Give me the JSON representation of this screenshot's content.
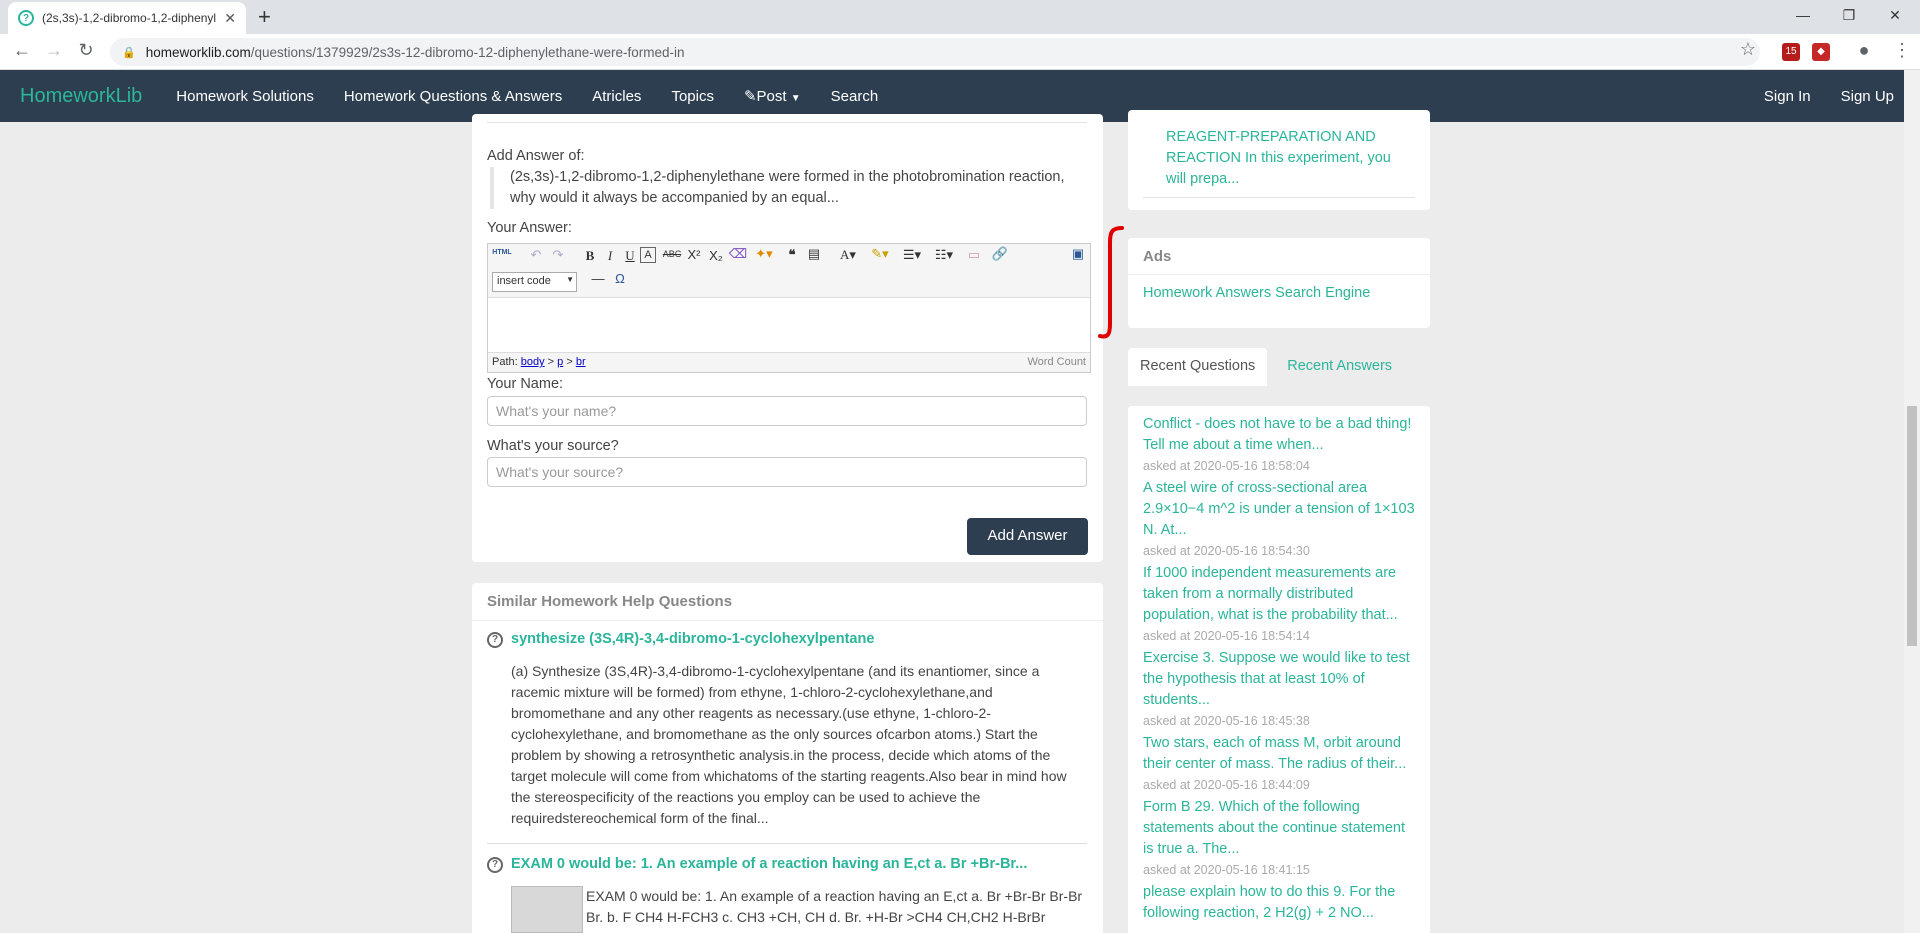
{
  "browser": {
    "tab_title": "(2s,3s)-1,2-dibromo-1,2-diphenyl",
    "url_host": "homeworklib.com",
    "url_path": "/questions/1379929/2s3s-12-dibromo-12-diphenylethane-were-formed-in",
    "ext_badge": "15"
  },
  "nav": {
    "brand": "HomeworkLib",
    "links": [
      "Homework Solutions",
      "Homework Questions & Answers",
      "Atricles",
      "Topics",
      "Post",
      "Search"
    ],
    "sign_in": "Sign In",
    "sign_up": "Sign Up"
  },
  "answer_form": {
    "add_answer_of": "Add Answer of:",
    "question_excerpt": "(2s,3s)-1,2-dibromo-1,2-diphenylethane were formed in the photobromination reaction, why would it always be accompanied by an equal...",
    "your_answer": "Your Answer:",
    "insert_code": "insert code",
    "path_label": "Path:",
    "path_body": "body",
    "path_p": "p",
    "path_br": "br",
    "word_count": "Word Count",
    "your_name": "Your Name:",
    "name_placeholder": "What's your name?",
    "your_source": "What's your source?",
    "source_placeholder": "What's your source?",
    "submit": "Add Answer"
  },
  "similar": {
    "heading": "Similar Homework Help Questions",
    "items": [
      {
        "title": "synthesize (3S,4R)-3,4-dibromo-1-cyclohexylpentane",
        "body": "(a) Synthesize (3S,4R)-3,4-dibromo-1-cyclohexylpentane (and its enantiomer, since a racemic mixture will be formed) from ethyne, 1-chloro-2-cyclohexylethane,and bromomethane and any other reagents as necessary.(use ethyne, 1-chloro-2-cyclohexylethane, and bromomethane as the only sources ofcarbon atoms.) Start the problem by showing a retrosynthetic analysis.in the process, decide which atoms of the target molecule will come from whichatoms of the starting reagents.Also bear in mind how the stereospecificity of the reactions you employ can be used to achieve the requiredstereochemical form of the final..."
      },
      {
        "title": "EXAM 0 would be: 1. An example of a reaction having an E,ct a. Br +Br-Br...",
        "body": "EXAM 0 would be: 1. An example of a reaction having an E,ct a. Br +Br-Br Br-Br Br. b. F CH4 H-FCH3 c. CH3 +CH, CH d. Br. +H-Br >CH4 CH,CH2 H-BrBr"
      }
    ]
  },
  "sidebar": {
    "top_snippet": "REAGENT-PREPARATION AND REACTION In this experiment, you will prepa...",
    "ads_heading": "Ads",
    "ads_link": "Homework Answers Search Engine",
    "tab_recent_questions": "Recent Questions",
    "tab_recent_answers": "Recent Answers",
    "recent": [
      {
        "q": "Conflict - does not have to be a bad thing! Tell me about a time when...",
        "t": "asked at 2020-05-16 18:58:04"
      },
      {
        "q": "A steel wire of cross-sectional area 2.9×10−4 m^2 is under a tension of 1×103 N. At...",
        "t": "asked at 2020-05-16 18:54:30"
      },
      {
        "q": "If 1000 independent measurements are taken from a normally distributed population, what is the probability that...",
        "t": "asked at 2020-05-16 18:54:14"
      },
      {
        "q": "Exercise 3. Suppose we would like to test the hypothesis that at least 10% of students...",
        "t": "asked at 2020-05-16 18:45:38"
      },
      {
        "q": "Two stars, each of mass M, orbit around their center of mass. The radius of their...",
        "t": "asked at 2020-05-16 18:44:09"
      },
      {
        "q": "Form B 29. Which of the following statements about the continue statement is true a. The...",
        "t": "asked at 2020-05-16 18:41:15"
      },
      {
        "q": "please explain how to do this 9. For the following reaction, 2 H2(g) + 2 NO...",
        "t": ""
      }
    ]
  }
}
